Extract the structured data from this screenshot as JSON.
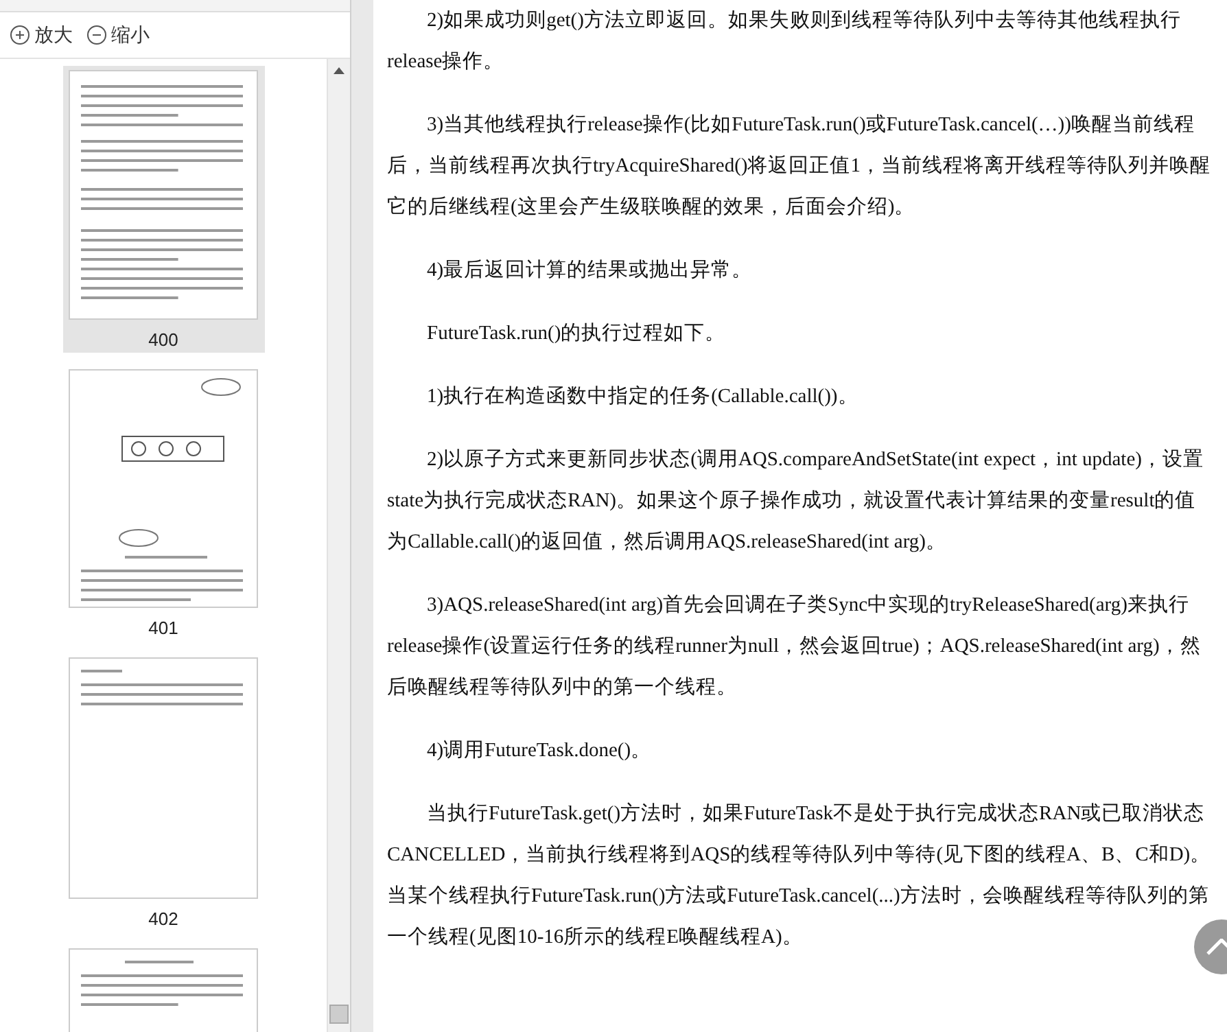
{
  "toolbar": [
    {
      "kind": "zoom-in",
      "label": "放大"
    },
    {
      "kind": "zoom-out",
      "label": "缩小"
    }
  ],
  "thumbnails": [
    {
      "kind": "text",
      "page": "400",
      "selected": true
    },
    {
      "kind": "diagram",
      "page": "401",
      "selected": false
    },
    {
      "kind": "section",
      "page": "402",
      "selected": false
    },
    {
      "kind": "chapter",
      "selected": false
    }
  ],
  "paragraphs": [
    "2)如果成功则get()方法立即返回。如果失败则到线程等待队列中去等待其他线程执行release操作。",
    "3)当其他线程执行release操作(比如FutureTask.run()或FutureTask.cancel(…))唤醒当前线程后，当前线程再次执行tryAcquireShared()将返回正值1，当前线程将离开线程等待队列并唤醒它的后继线程(这里会产生级联唤醒的效果，后面会介绍)。",
    "4)最后返回计算的结果或抛出异常。",
    "FutureTask.run()的执行过程如下。",
    "1)执行在构造函数中指定的任务(Callable.call())。",
    "2)以原子方式来更新同步状态(调用AQS.compareAndSetState(int expect，int update)，设置state为执行完成状态RAN)。如果这个原子操作成功，就设置代表计算结果的变量result的值为Callable.call()的返回值，然后调用AQS.releaseShared(int arg)。",
    "3)AQS.releaseShared(int arg)首先会回调在子类Sync中实现的tryReleaseShared(arg)来执行release操作(设置运行任务的线程runner为null，然会返回true)；AQS.releaseShared(int arg)，然后唤醒线程等待队列中的第一个线程。",
    "4)调用FutureTask.done()。",
    "当执行FutureTask.get()方法时，如果FutureTask不是处于执行完成状态RAN或已取消状态CANCELLED，当前执行线程将到AQS的线程等待队列中等待(见下图的线程A、B、C和D)。当某个线程执行FutureTask.run()方法或FutureTask.cancel(...)方法时，会唤醒线程等待队列的第一个线程(见图10-16所示的线程E唤醒线程A)。"
  ]
}
